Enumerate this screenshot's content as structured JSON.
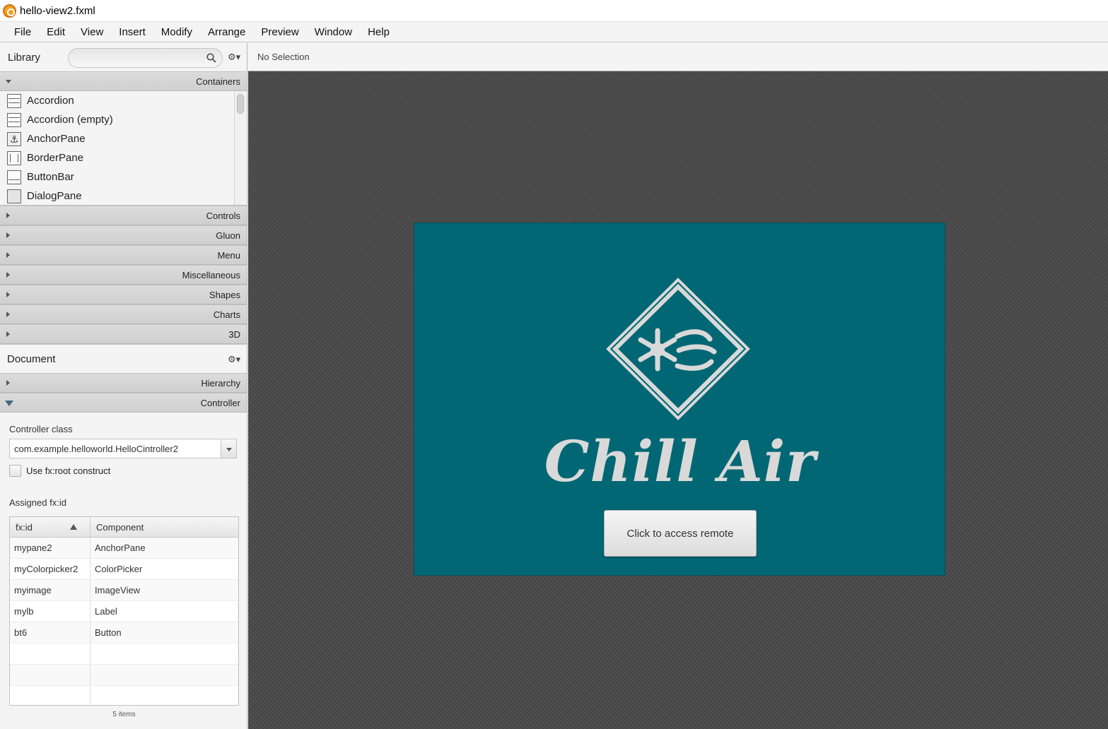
{
  "window": {
    "title": "hello-view2.fxml"
  },
  "menu": {
    "items": [
      "File",
      "Edit",
      "View",
      "Insert",
      "Modify",
      "Arrange",
      "Preview",
      "Window",
      "Help"
    ]
  },
  "library": {
    "title": "Library",
    "search_placeholder": "",
    "sections": {
      "containers": "Containers",
      "controls": "Controls",
      "gluon": "Gluon",
      "menu": "Menu",
      "miscellaneous": "Miscellaneous",
      "shapes": "Shapes",
      "charts": "Charts",
      "threed": "3D"
    },
    "items": [
      {
        "label": "Accordion",
        "icon": "accordion-icon"
      },
      {
        "label": "Accordion  (empty)",
        "icon": "accordion-icon"
      },
      {
        "label": "AnchorPane",
        "icon": "anchor-icon"
      },
      {
        "label": "BorderPane",
        "icon": "borderpane-icon"
      },
      {
        "label": "ButtonBar",
        "icon": "buttonbar-icon"
      },
      {
        "label": "DialogPane",
        "icon": "dialogpane-icon"
      }
    ]
  },
  "document": {
    "title": "Document",
    "sections": {
      "hierarchy": "Hierarchy",
      "controller": "Controller"
    },
    "controller_class_label": "Controller class",
    "controller_class_value": "com.example.helloworld.HelloCintroller2",
    "use_root_label": "Use fx:root construct",
    "assigned_label": "Assigned fx:id",
    "table": {
      "headers": {
        "fxid": "fx:id",
        "component": "Component"
      },
      "rows": [
        {
          "fxid": "mypane2",
          "component": "AnchorPane"
        },
        {
          "fxid": "myColorpicker2",
          "component": "ColorPicker"
        },
        {
          "fxid": "myimage",
          "component": "ImageView"
        },
        {
          "fxid": "mylb",
          "component": "Label"
        },
        {
          "fxid": "bt6",
          "component": "Button"
        }
      ],
      "footer": "5 items"
    }
  },
  "content": {
    "selection_status": "No Selection",
    "pane_color": "#026774",
    "brand_name": "Chill Air",
    "button_label": "Click to access remote"
  }
}
